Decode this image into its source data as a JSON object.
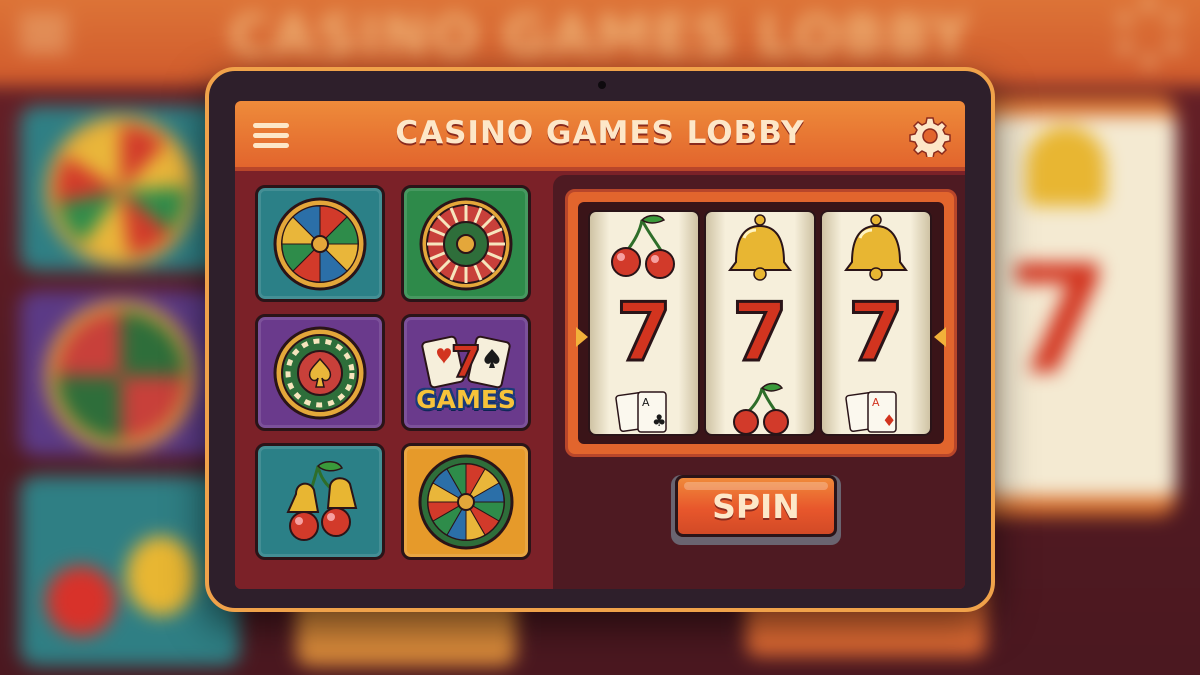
{
  "header": {
    "title": "CASINO GAMES LOBBY",
    "menu_icon": "hamburger-menu-icon",
    "settings_icon": "gear-icon"
  },
  "games": [
    {
      "id": "wheel-of-fortune",
      "icon": "fortune-wheel-icon",
      "tile_color": "#2b8087"
    },
    {
      "id": "roulette",
      "icon": "roulette-wheel-icon",
      "tile_color": "#2e8a4a"
    },
    {
      "id": "poker-chip",
      "icon": "poker-chip-icon",
      "tile_color": "#6a3a8c"
    },
    {
      "id": "card-games",
      "icon": "playing-cards-icon",
      "label": "GAMES",
      "tile_color": "#6a3a8c"
    },
    {
      "id": "fruit-slots",
      "icon": "cherries-bells-icon",
      "tile_color": "#2b8087"
    },
    {
      "id": "prize-wheel",
      "icon": "prize-wheel-icon",
      "tile_color": "#e69a2a"
    }
  ],
  "slot_machine": {
    "reels": [
      {
        "top": "cherry-icon",
        "middle": "7",
        "bottom": "playing-cards-icon"
      },
      {
        "top": "bell-icon",
        "middle": "7",
        "bottom": "cherry-icon"
      },
      {
        "top": "bell-icon",
        "middle": "7",
        "bottom": "playing-cards-icon"
      }
    ],
    "spin_label": "SPIN"
  },
  "colors": {
    "header": "#e2652d",
    "screen_bg": "#7b2128",
    "slot_bg": "#4e1a22",
    "accent_gold": "#f2b13a",
    "seven_red": "#d2341f"
  }
}
